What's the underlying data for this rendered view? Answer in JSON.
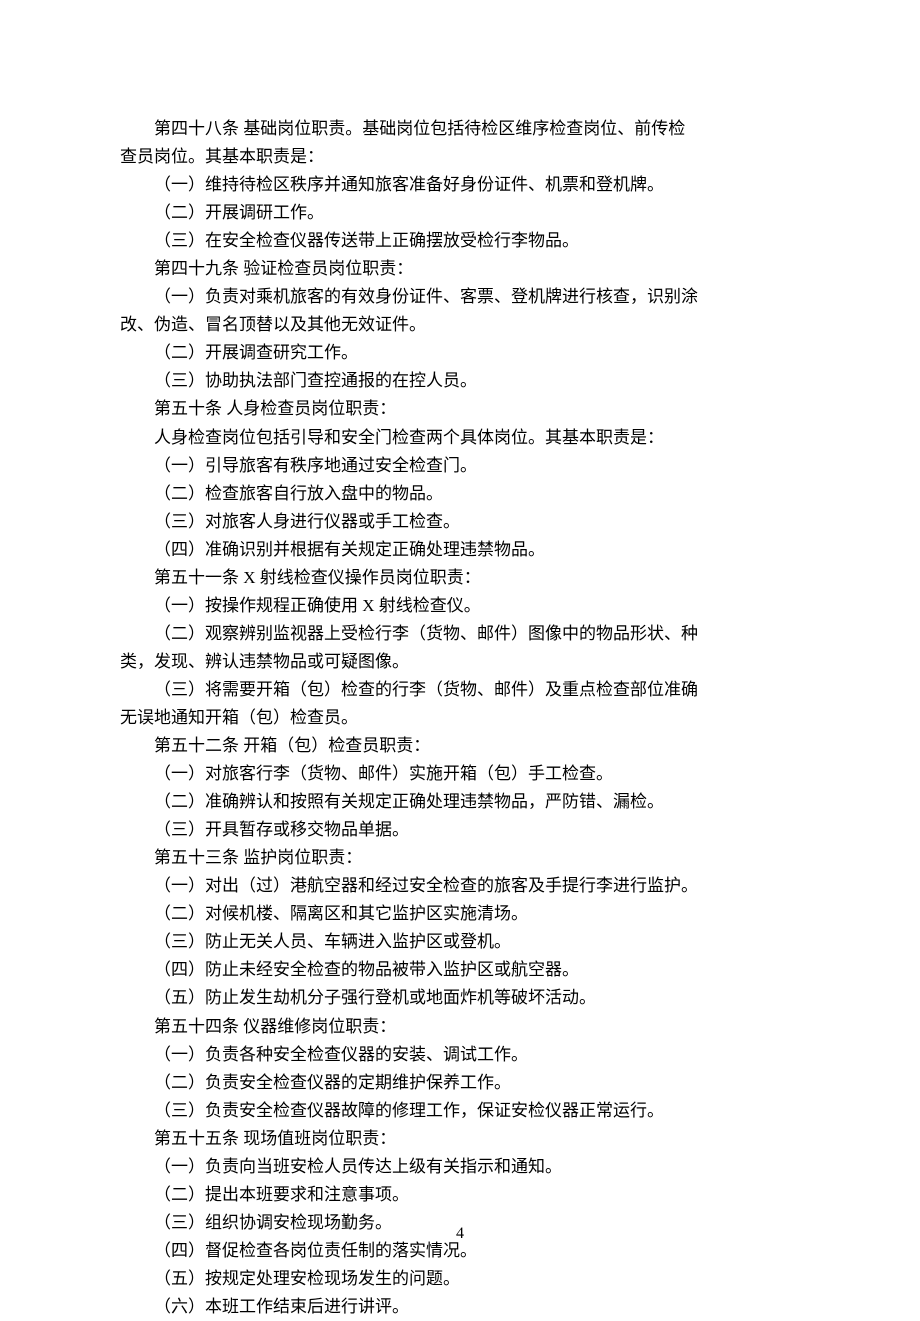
{
  "lines": [
    {
      "text": "第四十八条   基础岗位职责。基础岗位包括待检区维序检查岗位、前传检",
      "indent": true
    },
    {
      "text": "查员岗位。其基本职责是：",
      "indent": false
    },
    {
      "text": "（一）维持待检区秩序并通知旅客准备好身份证件、机票和登机牌。",
      "indent": true
    },
    {
      "text": "（二）开展调研工作。",
      "indent": true
    },
    {
      "text": "（三）在安全检查仪器传送带上正确摆放受检行李物品。",
      "indent": true
    },
    {
      "text": "第四十九条   验证检查员岗位职责：",
      "indent": true
    },
    {
      "text": "（一）负责对乘机旅客的有效身份证件、客票、登机牌进行核查，识别涂",
      "indent": true
    },
    {
      "text": "改、伪造、冒名顶替以及其他无效证件。",
      "indent": false
    },
    {
      "text": "（二）开展调查研究工作。",
      "indent": true
    },
    {
      "text": "（三）协助执法部门查控通报的在控人员。",
      "indent": true
    },
    {
      "text": "第五十条   人身检查员岗位职责：",
      "indent": true
    },
    {
      "text": "人身检查岗位包括引导和安全门检查两个具体岗位。其基本职责是：",
      "indent": true
    },
    {
      "text": "（一）引导旅客有秩序地通过安全检查门。",
      "indent": true
    },
    {
      "text": "（二）检查旅客自行放入盘中的物品。",
      "indent": true
    },
    {
      "text": "（三）对旅客人身进行仪器或手工检查。",
      "indent": true
    },
    {
      "text": "（四）准确识别并根据有关规定正确处理违禁物品。",
      "indent": true
    },
    {
      "text": "第五十一条   X 射线检查仪操作员岗位职责：",
      "indent": true
    },
    {
      "text": "（一）按操作规程正确使用 X 射线检查仪。",
      "indent": true
    },
    {
      "text": "（二）观察辨别监视器上受检行李（货物、邮件）图像中的物品形状、种",
      "indent": true
    },
    {
      "text": "类，发现、辨认违禁物品或可疑图像。",
      "indent": false
    },
    {
      "text": "（三）将需要开箱（包）检查的行李（货物、邮件）及重点检查部位准确",
      "indent": true
    },
    {
      "text": "无误地通知开箱（包）检查员。",
      "indent": false
    },
    {
      "text": "第五十二条   开箱（包）检查员职责：",
      "indent": true
    },
    {
      "text": "（一）对旅客行李（货物、邮件）实施开箱（包）手工检查。",
      "indent": true
    },
    {
      "text": "（二）准确辨认和按照有关规定正确处理违禁物品，严防错、漏检。",
      "indent": true
    },
    {
      "text": "（三）开具暂存或移交物品单据。",
      "indent": true
    },
    {
      "text": "第五十三条   监护岗位职责：",
      "indent": true
    },
    {
      "text": "（一）对出（过）港航空器和经过安全检查的旅客及手提行李进行监护。",
      "indent": true
    },
    {
      "text": "（二）对候机楼、隔离区和其它监护区实施清场。",
      "indent": true
    },
    {
      "text": "（三）防止无关人员、车辆进入监护区或登机。",
      "indent": true
    },
    {
      "text": "（四）防止未经安全检查的物品被带入监护区或航空器。",
      "indent": true
    },
    {
      "text": "（五）防止发生劫机分子强行登机或地面炸机等破坏活动。",
      "indent": true
    },
    {
      "text": "第五十四条   仪器维修岗位职责：",
      "indent": true
    },
    {
      "text": "（一）负责各种安全检查仪器的安装、调试工作。",
      "indent": true
    },
    {
      "text": "（二）负责安全检查仪器的定期维护保养工作。",
      "indent": true
    },
    {
      "text": "（三）负责安全检查仪器故障的修理工作，保证安检仪器正常运行。",
      "indent": true
    },
    {
      "text": "第五十五条   现场值班岗位职责：",
      "indent": true
    },
    {
      "text": "（一）负责向当班安检人员传达上级有关指示和通知。",
      "indent": true
    },
    {
      "text": "（二）提出本班要求和注意事项。",
      "indent": true
    },
    {
      "text": "（三）组织协调安检现场勤务。",
      "indent": true
    },
    {
      "text": "（四）督促检查各岗位责任制的落实情况。",
      "indent": true
    },
    {
      "text": "（五）按规定处理安检现场发生的问题。",
      "indent": true
    },
    {
      "text": "（六）本班工作结束后进行讲评。",
      "indent": true
    }
  ],
  "pageNumber": "4"
}
